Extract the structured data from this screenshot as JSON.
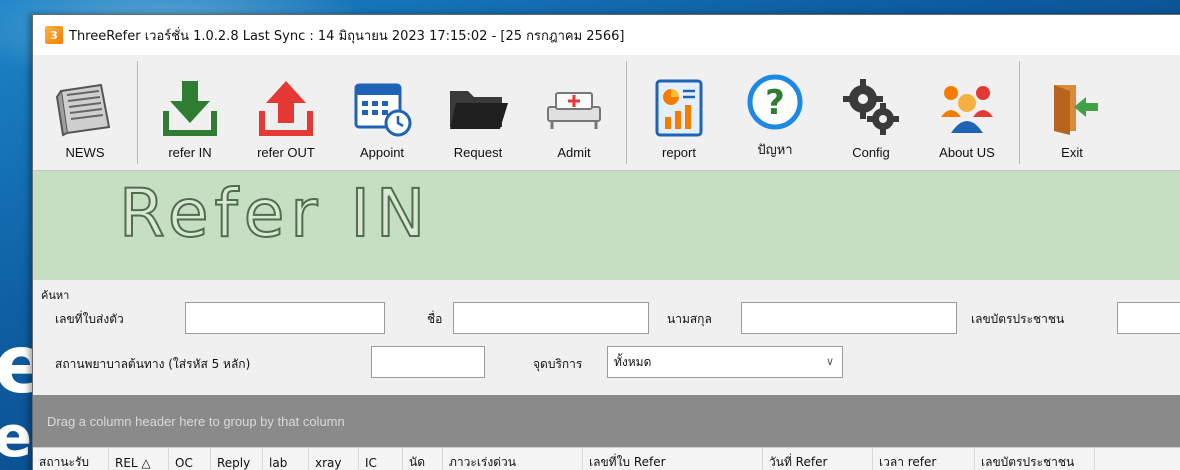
{
  "window": {
    "title": "ThreeRefer เวอร์ชั่น  1.0.2.8   Last Sync : 14 มิถุนายน 2023 17:15:02 - [25 กรกฎาคม 2566]"
  },
  "background": {
    "letter_1": "e",
    "letter_2": "e"
  },
  "toolbar": {
    "items": [
      {
        "label": "NEWS",
        "icon": "newspaper-icon"
      },
      {
        "label": "refer IN",
        "icon": "arrow-down-icon"
      },
      {
        "label": "refer OUT",
        "icon": "arrow-up-icon"
      },
      {
        "label": "Appoint",
        "icon": "calendar-icon"
      },
      {
        "label": "Request",
        "icon": "folder-icon"
      },
      {
        "label": "Admit",
        "icon": "hospital-bed-icon"
      },
      {
        "label": "report",
        "icon": "report-icon"
      },
      {
        "label": "ปัญหา",
        "icon": "help-icon"
      },
      {
        "label": "Config",
        "icon": "gear-icon"
      },
      {
        "label": "About US",
        "icon": "people-icon"
      },
      {
        "label": "Exit",
        "icon": "exit-icon"
      }
    ]
  },
  "banner": {
    "title": "Refer  IN"
  },
  "search": {
    "caption": "ค้นหา",
    "ref_label": "เลขที่ใบส่งตัว",
    "ref_value": "",
    "name_label": "ชื่อ",
    "name_value": "",
    "surname_label": "นามสกุล",
    "surname_value": "",
    "cid_label": "เลขบัตรประชาชน",
    "cid_value": "",
    "hospital_label": "สถานพยาบาลต้นทาง (ใส่รหัส 5 หลัก)",
    "hospital_value": "",
    "service_label": "จุดบริการ",
    "service_value": "ทั้งหมด"
  },
  "grid": {
    "group_hint": "Drag a column header here to group by that column",
    "columns": [
      "สถานะรับ",
      "REL △",
      "OC",
      "Reply",
      "lab",
      "xray",
      "IC",
      "นัด",
      "ภาวะเร่งด่วน",
      "เลขที่ใบ Refer",
      "วันที่ Refer",
      "เวลา refer",
      "เลขบัตรประชาชน"
    ]
  },
  "colors": {
    "banner_bg": "#c6dfc2",
    "refer_in_arrow": "#2e7d32",
    "refer_out_arrow": "#e53935",
    "group_bar": "#8a8a8a"
  }
}
